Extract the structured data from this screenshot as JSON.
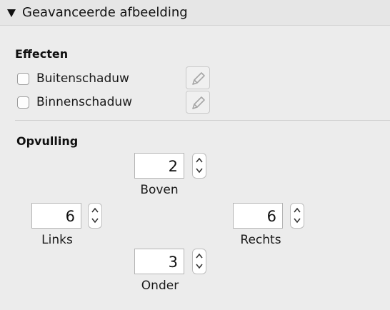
{
  "section": {
    "title": "Geavanceerde afbeelding",
    "expanded": true
  },
  "effects": {
    "title": "Effecten",
    "items": [
      {
        "label": "Buitenschaduw",
        "checked": false,
        "edit_icon": "pencil-icon"
      },
      {
        "label": "Binnenschaduw",
        "checked": false,
        "edit_icon": "pencil-icon"
      }
    ]
  },
  "padding": {
    "title": "Opvulling",
    "top": {
      "label": "Boven",
      "value": "2"
    },
    "left": {
      "label": "Links",
      "value": "6"
    },
    "right": {
      "label": "Rechts",
      "value": "6"
    },
    "bottom": {
      "label": "Onder",
      "value": "3"
    }
  },
  "colors": {
    "background": "#ececec",
    "header_background": "#e6e6e6"
  }
}
